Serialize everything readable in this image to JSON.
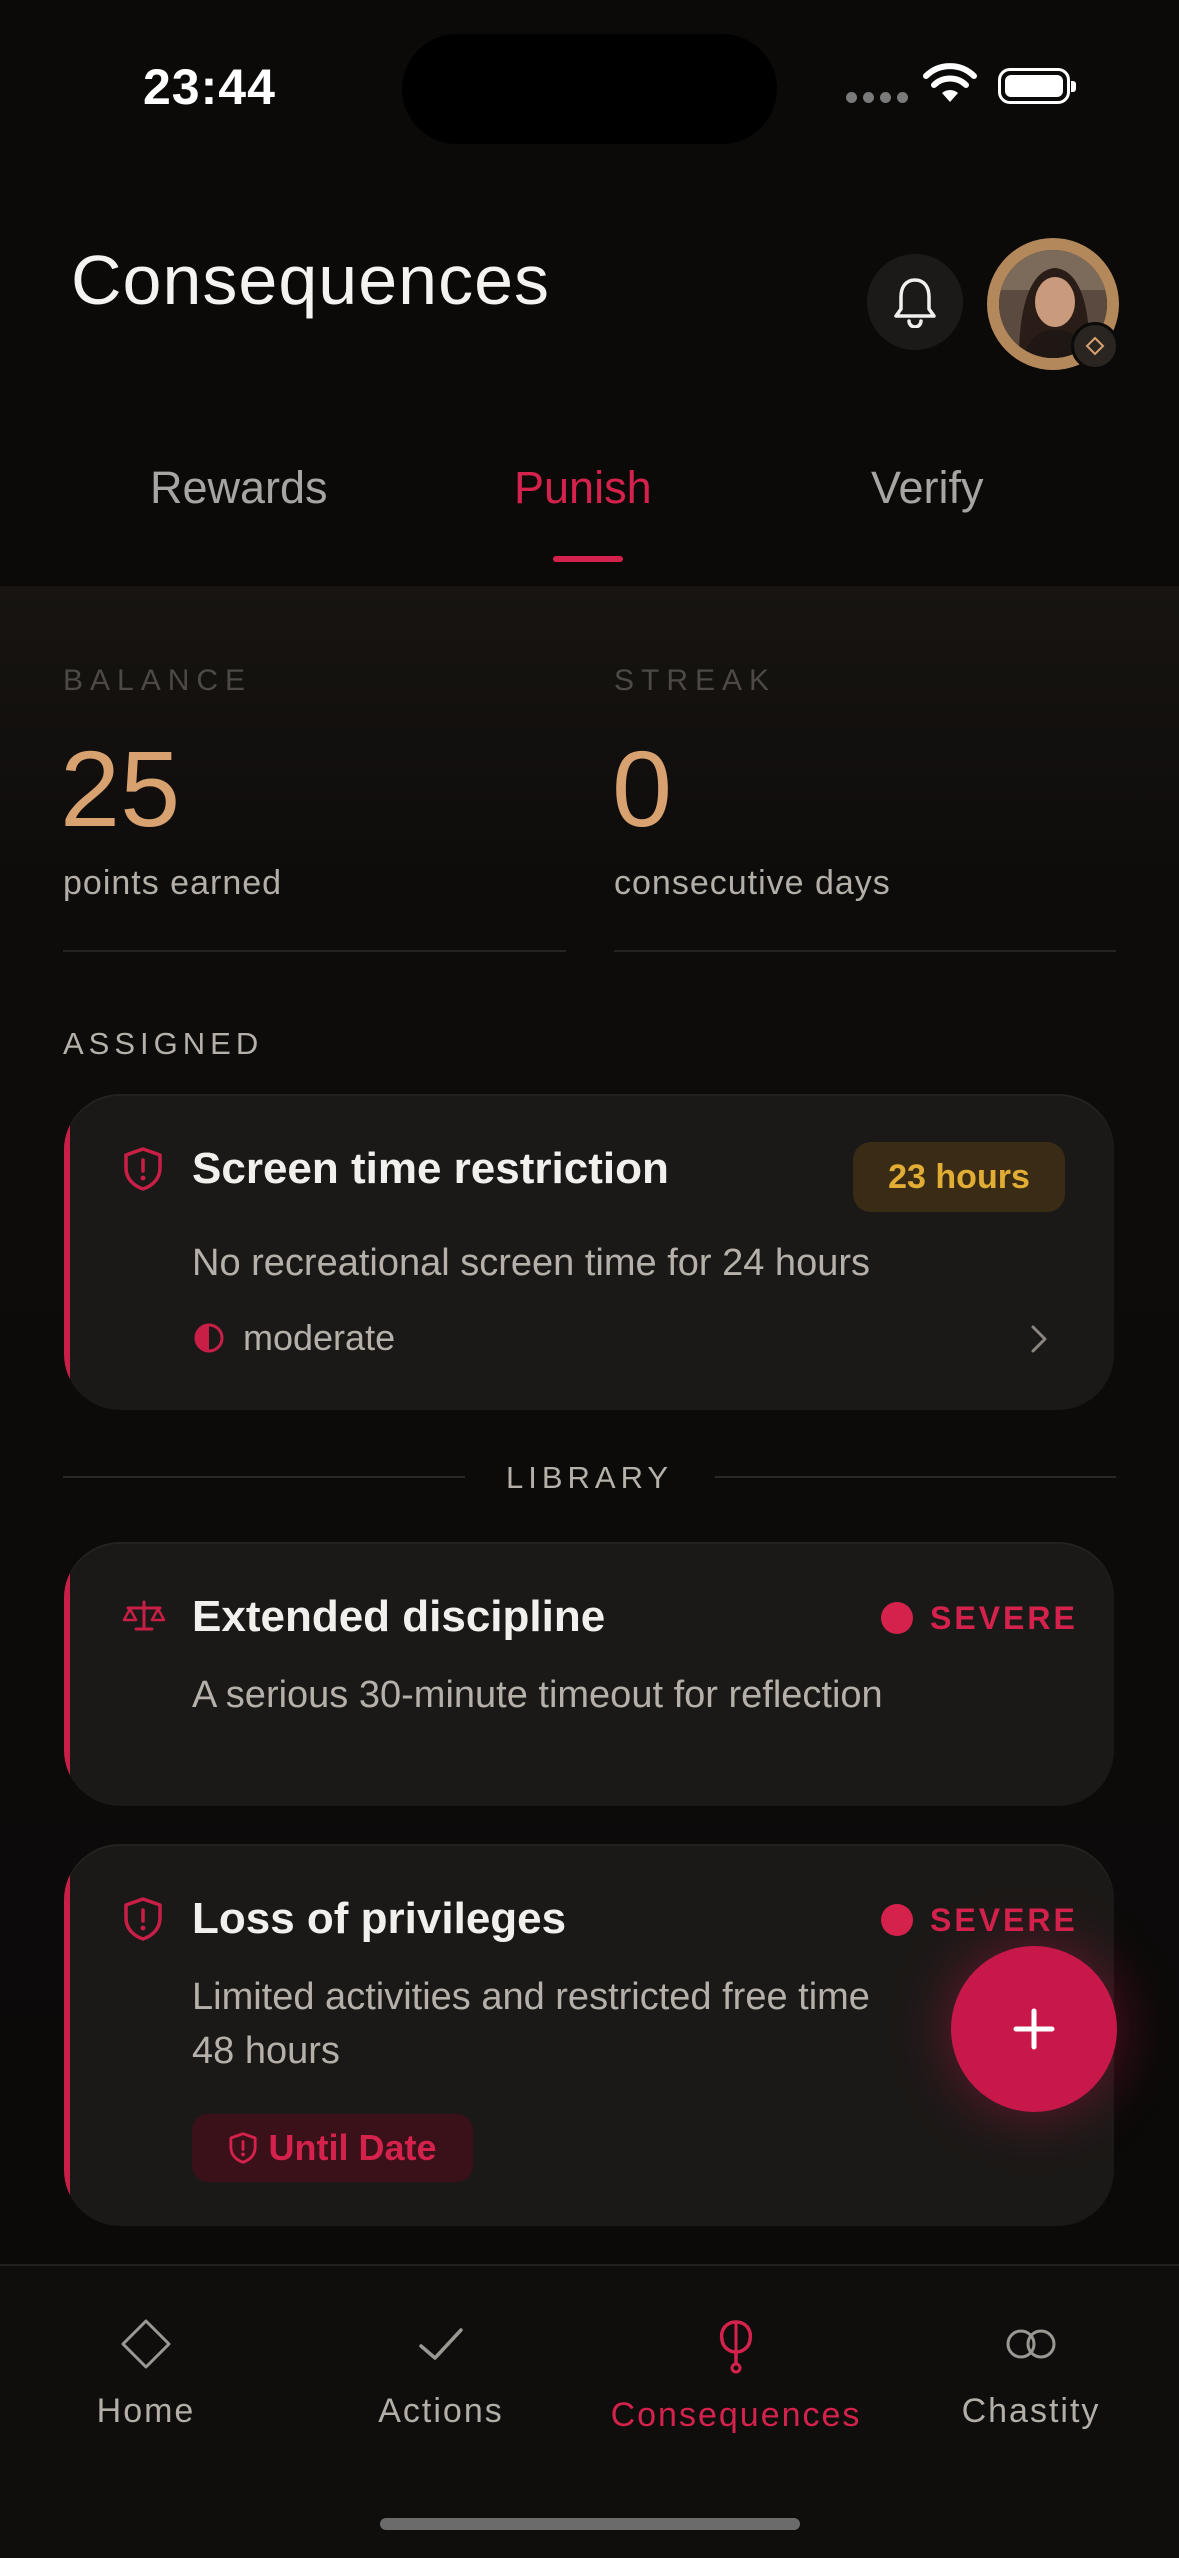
{
  "status_bar": {
    "time": "23:44"
  },
  "header": {
    "title": "Consequences"
  },
  "tabs": [
    {
      "label": "Rewards",
      "active": false
    },
    {
      "label": "Punish",
      "active": true
    },
    {
      "label": "Verify",
      "active": false
    }
  ],
  "stats": {
    "balance": {
      "label": "BALANCE",
      "value": "25",
      "sub": "points earned"
    },
    "streak": {
      "label": "STREAK",
      "value": "0",
      "sub": "consecutive days"
    }
  },
  "assigned": {
    "section_label": "ASSIGNED",
    "card": {
      "title": "Screen time restriction",
      "badge": "23 hours",
      "description": "No recreational screen time for 24 hours",
      "severity": "moderate"
    }
  },
  "library": {
    "section_label": "LIBRARY",
    "cards": [
      {
        "title": "Extended discipline",
        "severity": "SEVERE",
        "description": "A serious 30-minute timeout for reflection",
        "icon": "scale-icon"
      },
      {
        "title": "Loss of privileges",
        "severity": "SEVERE",
        "description_line1": "Limited activities and restricted free time",
        "description_line2": "48 hours",
        "tag": "Until Date",
        "icon": "shield-alert-icon"
      }
    ]
  },
  "fab": {
    "icon": "plus-icon"
  },
  "bottom_nav": [
    {
      "label": "Home",
      "icon": "diamond-icon",
      "active": false
    },
    {
      "label": "Actions",
      "icon": "check-icon",
      "active": false
    },
    {
      "label": "Consequences",
      "icon": "consequences-icon",
      "active": true
    },
    {
      "label": "Chastity",
      "icon": "rings-icon",
      "active": false
    }
  ],
  "colors": {
    "accent": "#d4224c",
    "gold": "#d7a170",
    "amber": "#e1ad35",
    "background": "#0b0a09"
  }
}
